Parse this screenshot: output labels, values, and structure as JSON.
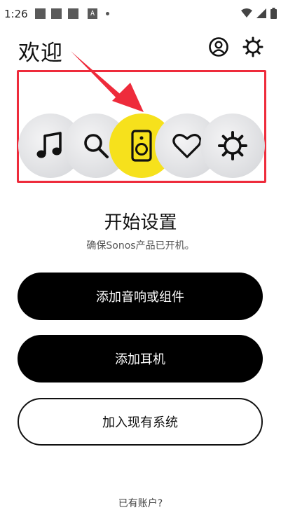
{
  "status_bar": {
    "time": "1:26",
    "notif_letter": "A"
  },
  "header": {
    "title": "欢迎",
    "account_icon": "account-circle-icon",
    "settings_icon": "gear-icon"
  },
  "tabs": [
    {
      "name": "music",
      "icon": "music-note-icon",
      "active": false
    },
    {
      "name": "search",
      "icon": "search-icon",
      "active": false
    },
    {
      "name": "system",
      "icon": "speaker-icon",
      "active": true
    },
    {
      "name": "favorites",
      "icon": "heart-icon",
      "active": false
    },
    {
      "name": "settings",
      "icon": "gear-icon",
      "active": false
    }
  ],
  "setup": {
    "title": "开始设置",
    "subtitle": "确保Sonos产品已开机。"
  },
  "buttons": {
    "add_speaker": "添加音响或组件",
    "add_headphones": "添加耳机",
    "join_system": "加入现有系统"
  },
  "footer": {
    "link_text": "已有账户?"
  },
  "colors": {
    "accent": "#f6e11c",
    "highlight": "#ee2b3b",
    "button_dark": "#000000"
  }
}
